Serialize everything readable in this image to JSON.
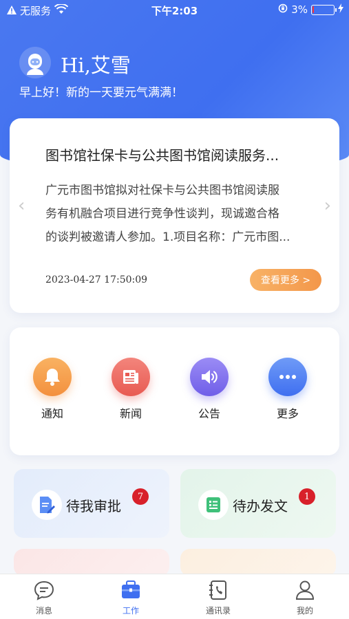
{
  "status_bar": {
    "carrier": "无服务",
    "time": "下午2:03",
    "battery": "3%",
    "battery_level": 0.03
  },
  "header": {
    "greeting": "Hi,艾雪",
    "subtitle": "早上好！新的一天要元气满满！"
  },
  "news": {
    "title": "图书馆社保卡与公共图书馆阅读服务...",
    "body_line1": "广元市图书馆拟对社保卡与公共图书馆阅读服",
    "body_line2": "务有机融合项目进行竞争性谈判，现诚邀合格",
    "body_line3": "的谈判被邀请人参加。1.项目名称：广元市图...",
    "date": "2023-04-27 17:50:09",
    "more_label": "查看更多 >"
  },
  "quick_actions": [
    {
      "label": "通知",
      "icon": "bell-icon",
      "color": "#f5a04a"
    },
    {
      "label": "新闻",
      "icon": "newspaper-icon",
      "color": "#ef6b63"
    },
    {
      "label": "公告",
      "icon": "speaker-icon",
      "color": "#7f6ff0"
    },
    {
      "label": "更多",
      "icon": "more-dots-icon",
      "color": "#4b7ff2"
    }
  ],
  "tasks": [
    {
      "label": "待我审批",
      "count": "7",
      "icon": "approval-doc-icon"
    },
    {
      "label": "待办发文",
      "count": "1",
      "icon": "document-list-icon"
    }
  ],
  "tabbar": [
    {
      "label": "消息",
      "icon": "message-icon"
    },
    {
      "label": "工作",
      "icon": "briefcase-icon",
      "active": true
    },
    {
      "label": "通讯录",
      "icon": "contacts-icon"
    },
    {
      "label": "我的",
      "icon": "user-icon"
    }
  ]
}
